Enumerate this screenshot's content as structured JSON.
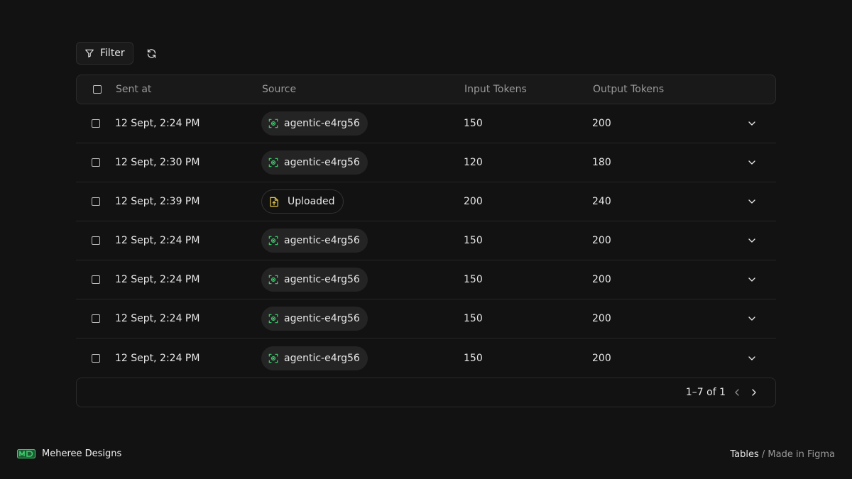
{
  "toolbar": {
    "filter_label": "Filter"
  },
  "table": {
    "headers": {
      "sent_at": "Sent at",
      "source": "Source",
      "input_tokens": "Input Tokens",
      "output_tokens": "Output Tokens"
    },
    "rows": [
      {
        "sent_at": "12 Sept, 2:24 PM",
        "source": "agentic-e4rg56",
        "source_type": "agentic",
        "input_tokens": "150",
        "output_tokens": "200"
      },
      {
        "sent_at": "12 Sept, 2:30 PM",
        "source": "agentic-e4rg56",
        "source_type": "agentic",
        "input_tokens": "120",
        "output_tokens": "180"
      },
      {
        "sent_at": "12 Sept, 2:39 PM",
        "source": "Uploaded",
        "source_type": "uploaded",
        "input_tokens": "200",
        "output_tokens": "240"
      },
      {
        "sent_at": "12 Sept, 2:24 PM",
        "source": "agentic-e4rg56",
        "source_type": "agentic",
        "input_tokens": "150",
        "output_tokens": "200"
      },
      {
        "sent_at": "12 Sept, 2:24 PM",
        "source": "agentic-e4rg56",
        "source_type": "agentic",
        "input_tokens": "150",
        "output_tokens": "200"
      },
      {
        "sent_at": "12 Sept, 2:24 PM",
        "source": "agentic-e4rg56",
        "source_type": "agentic",
        "input_tokens": "150",
        "output_tokens": "200"
      },
      {
        "sent_at": "12 Sept, 2:24 PM",
        "source": "agentic-e4rg56",
        "source_type": "agentic",
        "input_tokens": "150",
        "output_tokens": "200"
      }
    ]
  },
  "pagination": {
    "range_text": "1–7 of 1"
  },
  "footer": {
    "brand_name": "Meheree Designs",
    "credit_strong": "Tables",
    "credit_rest": " / Made in Figma"
  },
  "colors": {
    "background": "#121212",
    "agentic_icon": "#3ecf6e",
    "uploaded_icon": "#e3c64a",
    "brand_logo": "#3ecf6e"
  },
  "icons": {
    "filter": "filter-icon",
    "refresh": "refresh-icon",
    "agentic": "agent-scan-icon",
    "uploaded": "file-upload-icon",
    "expand": "chevron-down-icon",
    "prev": "chevron-left-icon",
    "next": "chevron-right-icon"
  }
}
